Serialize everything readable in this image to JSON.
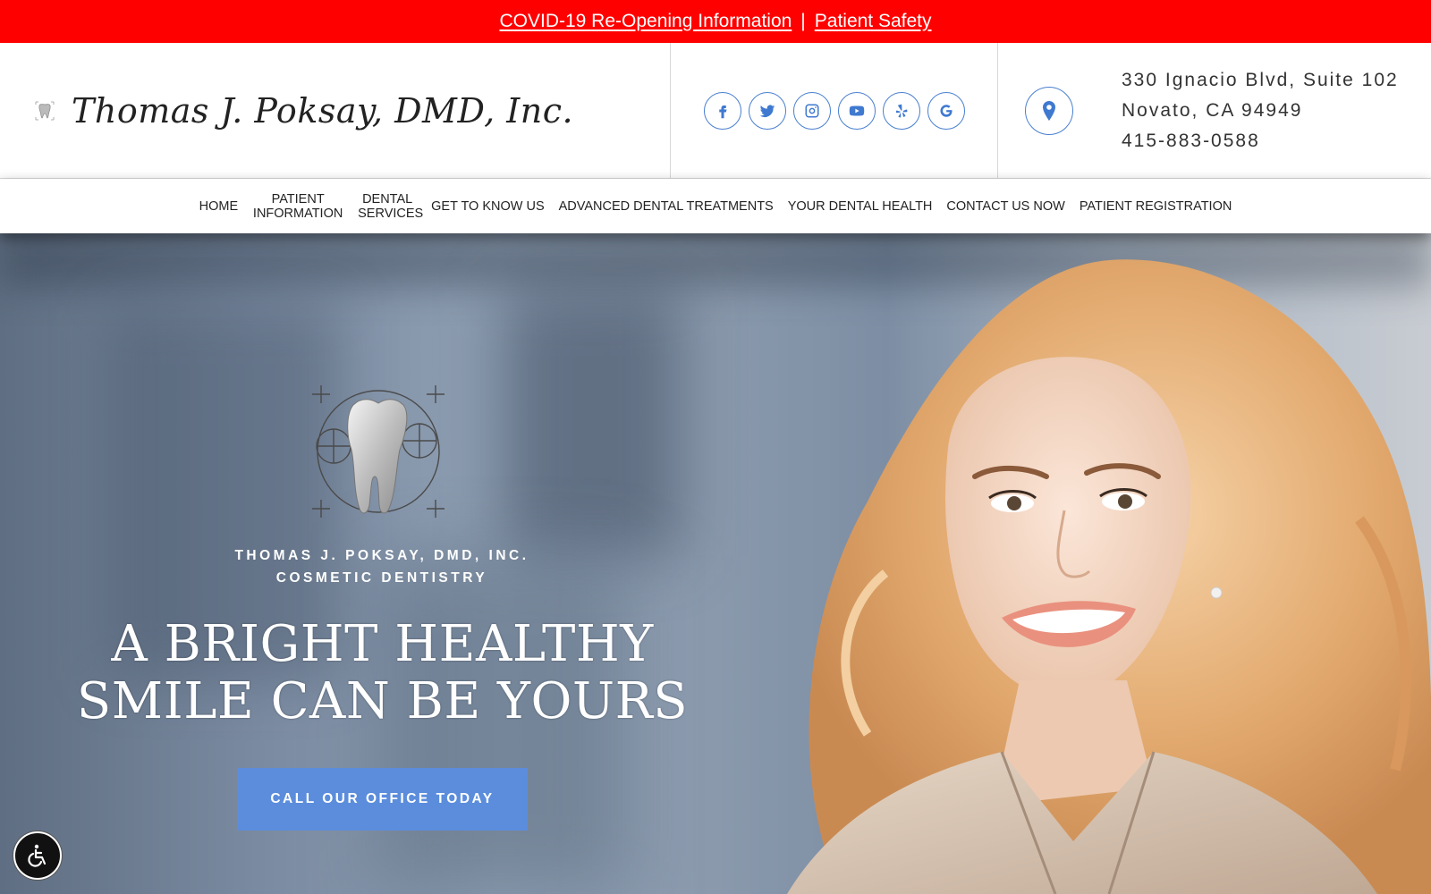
{
  "alert": {
    "covid_link": "COVID-19 Re-Opening Information",
    "separator": "|",
    "safety_link": "Patient Safety"
  },
  "header": {
    "practice_name": "Thomas J. Poksay, DMD, Inc.",
    "social_icons": [
      "facebook-icon",
      "twitter-icon",
      "instagram-icon",
      "youtube-icon",
      "yelp-icon",
      "google-icon"
    ],
    "address_line1": "330 Ignacio Blvd, Suite 102",
    "address_line2": "Novato, CA 94949",
    "phone": "415-883-0588"
  },
  "nav": {
    "items": [
      {
        "label": "Home"
      },
      {
        "label": "Patient Information"
      },
      {
        "label": "Dental Services"
      },
      {
        "label": "Get to Know Us"
      },
      {
        "label": "Advanced Dental Treatments"
      },
      {
        "label": "Your Dental Health"
      },
      {
        "label": "Contact Us Now"
      },
      {
        "label": "Patient Registration"
      }
    ]
  },
  "hero": {
    "practice_line1": "THOMAS J. POKSAY, DMD, INC.",
    "practice_line2": "COSMETIC DENTISTRY",
    "headline_line1": "A BRIGHT HEALTHY",
    "headline_line2": "SMILE CAN BE YOURS",
    "cta_label": "CALL OUR OFFICE TODAY"
  },
  "colors": {
    "alert_bg": "#ff0000",
    "accent_blue": "#5b8ddc",
    "icon_blue": "#3f79d0"
  }
}
